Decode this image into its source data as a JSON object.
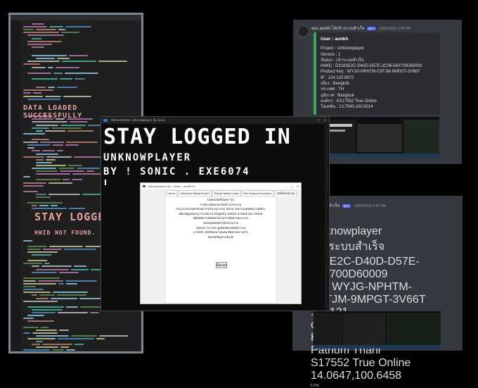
{
  "editor": {
    "banner_loaded": "DATA LOADED SUCCESSFULLY",
    "banner_stay": "STAY LOGGED",
    "banner_hwid": "HWID NOT FOUND."
  },
  "discord_top": {
    "username": "คุณ aunkh ได้เข้าระบบสำเร็จ",
    "bot_tag": "BOT",
    "timestamp": "10/06/2022 1:24 PM",
    "user_line": "User : aunkh",
    "fields": [
      "Project : Unknowplayer",
      "Version : 1",
      "Status : เข้าระบบสำเร็จ",
      "HWID : D3180E2C-D40D-D57E-2C06-540700D60009",
      "Product Key : WYJG-NPHTM-C9TJM-9MPGT-3V66T",
      "IP : 124.120.9972",
      "เมือง : Bangkok",
      "ประเทศ : TH",
      "ภูมิภาค : Bangkok",
      "องค์กร : AS17552 True Online",
      "โลเคชั่น : 13.7540,100.5014"
    ]
  },
  "discord_bottom": {
    "username": "ได้เข้าระบบไม่สำเร็จ",
    "bot_tag": "BOT",
    "timestamp": "10/09/2022 9:26 PM",
    "user_line": "unkh",
    "fields": [
      "Unknowplayer",
      "เข้าระบบสำเร็จ",
      "180E2C-D40D-D57E-540700D60009",
      "ey : WYJG-NPHTM-C9TJM-9MPGT-3V66T",
      ".90.121",
      "ong Luang",
      "H",
      "Pathum Thani",
      "S17552 True Online",
      "14.0647,100.6458"
    ],
    "footer": "5 PM"
  },
  "terminal": {
    "title": "Administrator: Unknowplayer By Sonic",
    "line1": "STAY LOGGED IN",
    "line2": "UNKNOWPLAYER",
    "line3": "BY ! SONIC . EXE6074"
  },
  "dialog": {
    "title": "Unknowplayer By ! Sonic . exe6074",
    "tabs": [
      "Home",
      "Hardcore Mode Punch",
      "Player Never Lose",
      "Set Unknow Function",
      "ปลดล็อกหน้าจอ"
    ],
    "lines": [
      "UnknowPlayer V1",
      "รายละเอียดเกี่ยวกับตัวโปรแกรม",
      "เป็นโปรแกรมที่ใช้ในการปรับปรุงระบบ Sonic ผลงานโดยทีมงานอิสระ",
      "เพื่อให้ผู้เล่นสามารถใช้งาน Registry Editor ผ่านหน้าจอ Fream",
      "เพื่อลดความผิดพลาดในการตั้งค่าของระบบ",
      "ขอบคุณที่เลือกใช้โปรแกรม",
      "กดหน้าเว็บ F95 ดูเพิ่มเติมได้ที่หน้าเว็บ",
      "2  mets  ได้ที่ช่องทางนี้เลย  ติดตามข่าวสาร",
      "พบเจอปัญหาแจ้งได้"
    ],
    "button": "Discord"
  }
}
